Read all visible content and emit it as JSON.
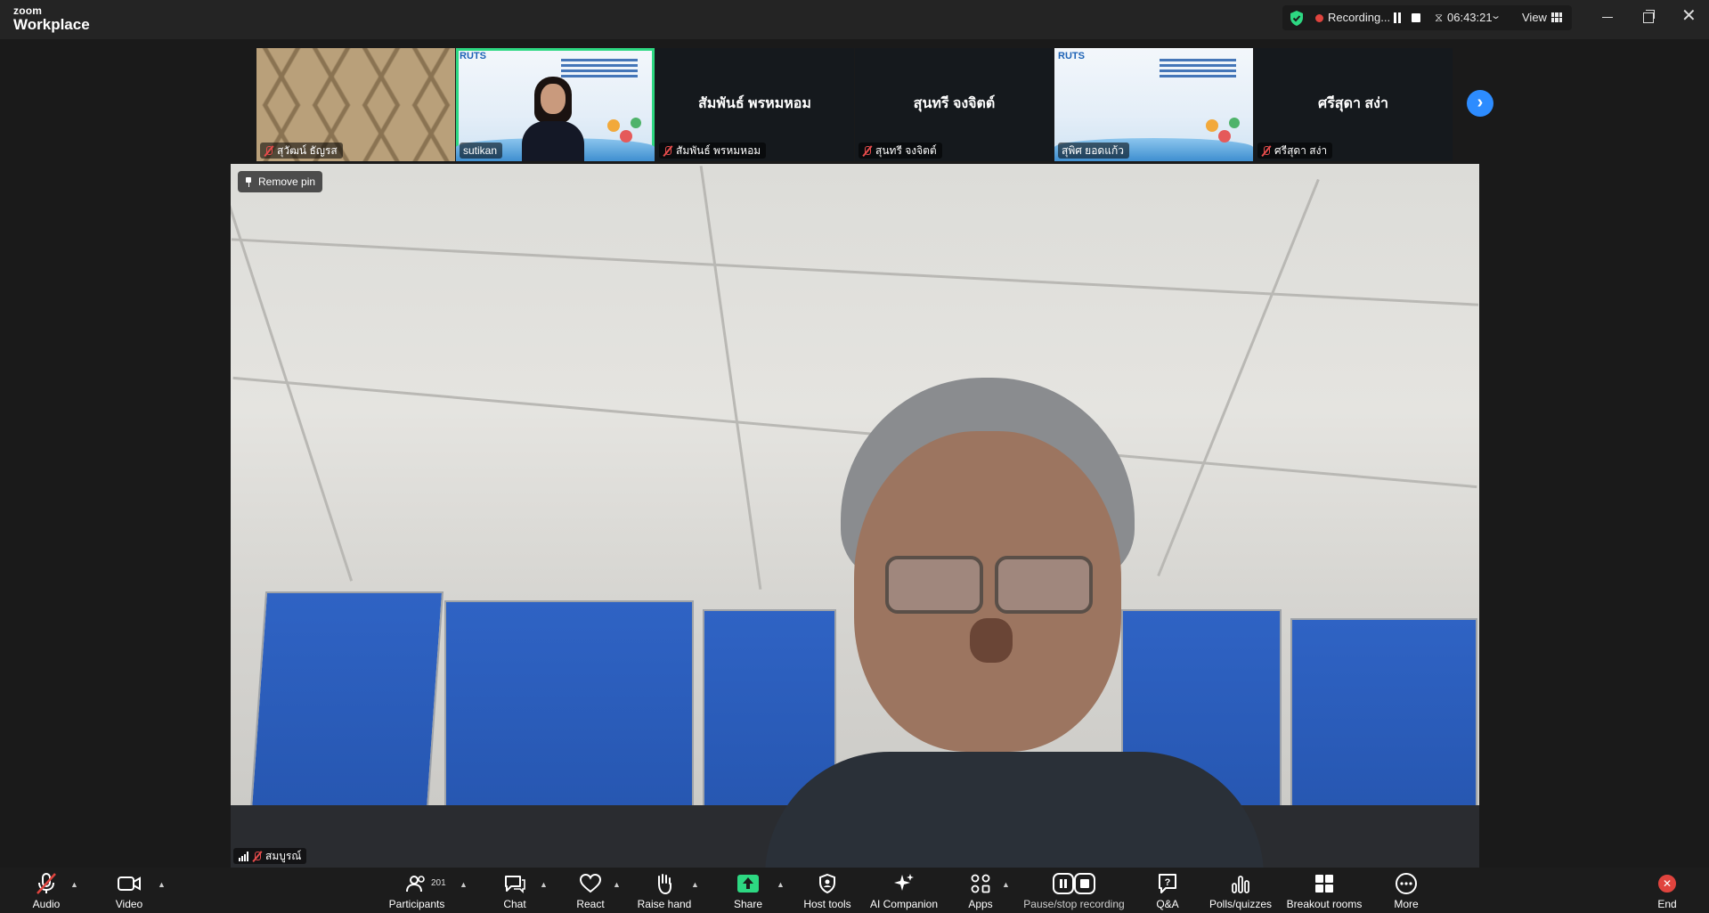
{
  "app": {
    "brand_small": "zoom",
    "brand_big": "Workplace"
  },
  "recording": {
    "status": "Recording...",
    "elapsed": "06:43:21",
    "view_label": "View"
  },
  "filmstrip": {
    "tiles": [
      {
        "name": "สุวัฒน์ ธัญรส",
        "display_name": "",
        "type": "video"
      },
      {
        "name": "sutikan",
        "display_name": "",
        "type": "video",
        "active": true
      },
      {
        "name": "สัมพันธ์ พรหมหอม",
        "display_name": "สัมพันธ์ พรหมหอม",
        "type": "name"
      },
      {
        "name": "สุนทรี จงจิตต์",
        "display_name": "สุนทรี จงจิตต์",
        "type": "name"
      },
      {
        "name": "สุพิศ ยอดแก้ว",
        "display_name": "",
        "type": "video"
      },
      {
        "name": "ศรีสุดา สง่า",
        "display_name": "ศรีสุดา สง่า",
        "type": "name"
      }
    ],
    "slide_brand": "RUTS"
  },
  "main": {
    "pin_label": "Remove pin",
    "speaker_name": "สมบูรณ์"
  },
  "toolbar": {
    "audio": "Audio",
    "video": "Video",
    "participants": "Participants",
    "participants_count": "201",
    "chat": "Chat",
    "react": "React",
    "raise_hand": "Raise hand",
    "share": "Share",
    "host_tools": "Host tools",
    "ai_companion": "AI Companion",
    "apps": "Apps",
    "pause_stop": "Pause/stop recording",
    "qa": "Q&A",
    "polls": "Polls/quizzes",
    "breakout": "Breakout rooms",
    "more": "More",
    "end": "End"
  },
  "colors": {
    "accent_green": "#2dd882",
    "accent_blue": "#2d8cff",
    "alert_red": "#e0443e"
  }
}
